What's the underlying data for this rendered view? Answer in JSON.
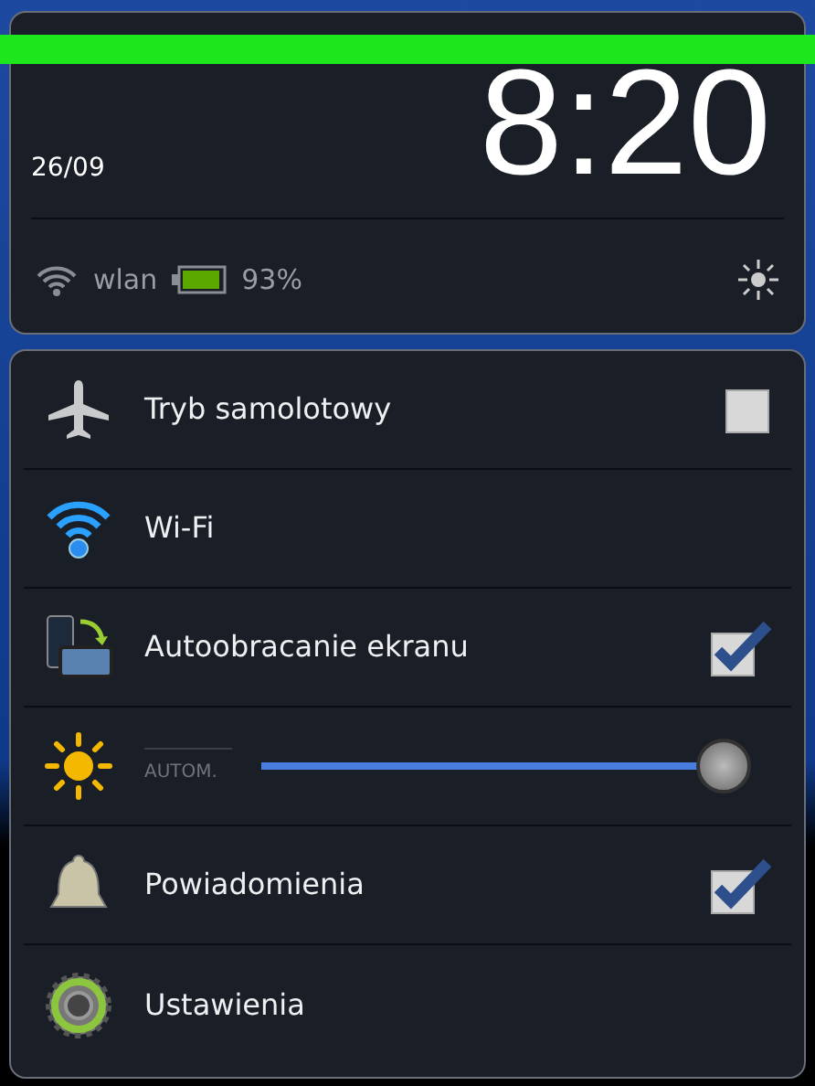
{
  "header": {
    "date": "26/09",
    "time": "8:20",
    "network": "wlan",
    "battery": "93%"
  },
  "settings": [
    {
      "kind": "checkbox",
      "label": "Tryb samolotowy",
      "checked": false
    },
    {
      "kind": "plain",
      "label": "Wi-Fi"
    },
    {
      "kind": "checkbox",
      "label": "Autoobracanie ekranu",
      "checked": true
    },
    {
      "kind": "slider",
      "auto_label": "AUTOM.",
      "level": 1.0
    },
    {
      "kind": "checkbox",
      "label": "Powiadomienia",
      "checked": true
    },
    {
      "kind": "plain",
      "label": "Ustawienia"
    }
  ]
}
